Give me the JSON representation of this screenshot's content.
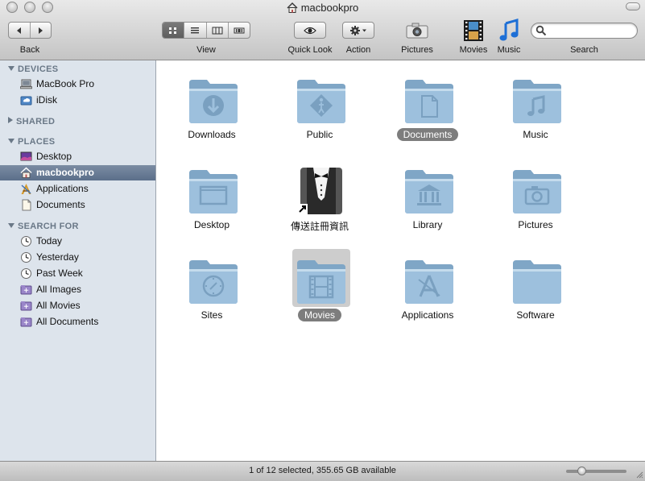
{
  "window": {
    "title": "macbookpro"
  },
  "toolbar": {
    "back_label": "Back",
    "view_label": "View",
    "quicklook_label": "Quick Look",
    "action_label": "Action",
    "pictures_label": "Pictures",
    "movies_label": "Movies",
    "music_label": "Music",
    "search_label": "Search",
    "search_value": "",
    "active_view": "icon"
  },
  "sidebar": {
    "devices": {
      "header": "DEVICES",
      "expanded": true,
      "items": [
        {
          "label": "MacBook Pro",
          "icon": "laptop-icon"
        },
        {
          "label": "iDisk",
          "icon": "idisk-icon"
        }
      ]
    },
    "shared": {
      "header": "SHARED",
      "expanded": false
    },
    "places": {
      "header": "PLACES",
      "expanded": true,
      "items": [
        {
          "label": "Desktop",
          "icon": "desktop-icon"
        },
        {
          "label": "macbookpro",
          "icon": "home-icon",
          "selected": true
        },
        {
          "label": "Applications",
          "icon": "applications-icon"
        },
        {
          "label": "Documents",
          "icon": "document-icon"
        }
      ]
    },
    "search_for": {
      "header": "SEARCH FOR",
      "expanded": true,
      "items": [
        {
          "label": "Today",
          "icon": "clock-icon"
        },
        {
          "label": "Yesterday",
          "icon": "clock-icon"
        },
        {
          "label": "Past Week",
          "icon": "clock-icon"
        },
        {
          "label": "All Images",
          "icon": "smart-folder-icon"
        },
        {
          "label": "All Movies",
          "icon": "smart-folder-icon"
        },
        {
          "label": "All Documents",
          "icon": "smart-folder-icon"
        }
      ]
    }
  },
  "files": [
    {
      "name": "Downloads",
      "icon": "downloads-folder-icon"
    },
    {
      "name": "Public",
      "icon": "public-folder-icon"
    },
    {
      "name": "Documents",
      "icon": "documents-folder-icon",
      "label_highlight": true
    },
    {
      "name": "Music",
      "icon": "music-folder-icon"
    },
    {
      "name": "Desktop",
      "icon": "desktop-folder-icon"
    },
    {
      "name": "傳送註冊資訊",
      "icon": "register-app-alias-icon"
    },
    {
      "name": "Library",
      "icon": "library-folder-icon"
    },
    {
      "name": "Pictures",
      "icon": "pictures-folder-icon"
    },
    {
      "name": "Sites",
      "icon": "sites-folder-icon"
    },
    {
      "name": "Movies",
      "icon": "movies-folder-icon",
      "selected": true
    },
    {
      "name": "Applications",
      "icon": "applications-folder-icon"
    },
    {
      "name": "Software",
      "icon": "folder-icon"
    }
  ],
  "status": {
    "text": "1 of 12 selected, 355.65 GB available",
    "icon_size_fraction": 0.25
  },
  "colors": {
    "folder": "#8fb3cf",
    "selection": "#7d7d7d",
    "sidebar_bg": "#dde4ec",
    "sidebar_selected": "#64778f"
  }
}
